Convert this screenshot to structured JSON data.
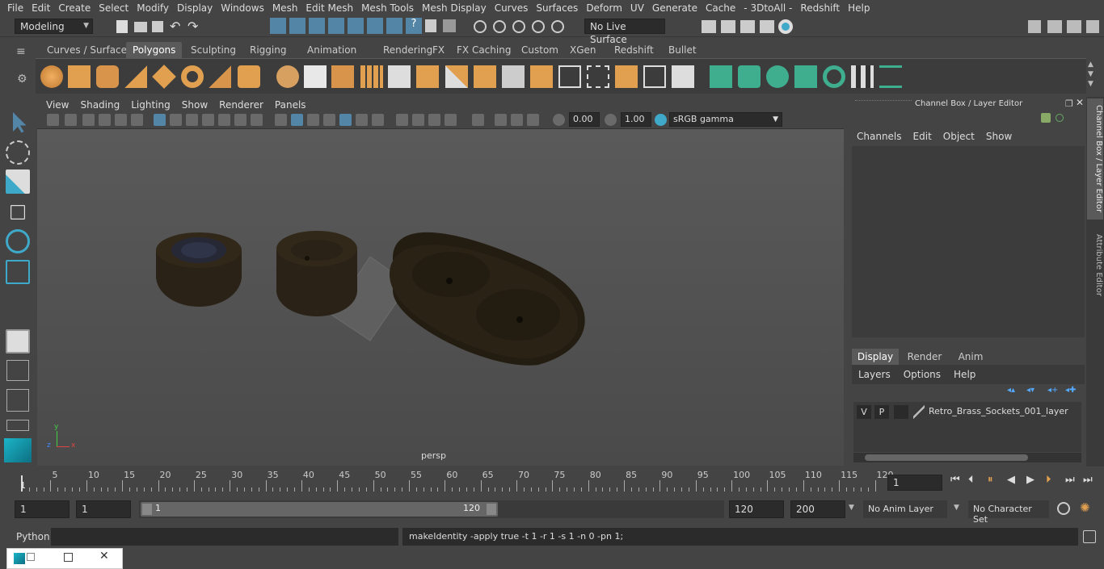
{
  "menubar": [
    "File",
    "Edit",
    "Create",
    "Select",
    "Modify",
    "Display",
    "Windows",
    "Mesh",
    "Edit Mesh",
    "Mesh Tools",
    "Mesh Display",
    "Curves",
    "Surfaces",
    "Deform",
    "UV",
    "Generate",
    "Cache",
    "- 3DtoAll -",
    "Redshift",
    "Help"
  ],
  "status": {
    "mode": "Modeling",
    "live_surface": "No Live Surface"
  },
  "shelf_tabs": [
    "Curves / Surfaces",
    "Polygons",
    "Sculpting",
    "Rigging",
    "Animation",
    "Rendering",
    "FX",
    "FX Caching",
    "Custom",
    "XGen",
    "Redshift",
    "Bullet"
  ],
  "shelf_active": "Polygons",
  "viewport": {
    "menu": [
      "View",
      "Shading",
      "Lighting",
      "Show",
      "Renderer",
      "Panels"
    ],
    "exposure": "0.00",
    "gamma": "1.00",
    "colorspace": "sRGB gamma",
    "camera": "persp",
    "axis_x": "x",
    "axis_y": "y",
    "axis_z": "z"
  },
  "channel_box": {
    "title": "Channel Box / Layer Editor",
    "menu": [
      "Channels",
      "Edit",
      "Object",
      "Show"
    ],
    "tabs": [
      "Display",
      "Render",
      "Anim"
    ],
    "active_tab": "Display",
    "layer_menu": [
      "Layers",
      "Options",
      "Help"
    ],
    "layer": {
      "v": "V",
      "p": "P",
      "name": "Retro_Brass_Sockets_001_layer"
    },
    "side_tabs": [
      "Channel Box / Layer Editor",
      "Attribute Editor"
    ]
  },
  "timeline": {
    "ticks": [
      5,
      10,
      15,
      20,
      25,
      30,
      35,
      40,
      45,
      50,
      55,
      60,
      65,
      70,
      75,
      80,
      85,
      90,
      95,
      100,
      105,
      110,
      115,
      120
    ],
    "start_label": "1",
    "current_frame": "1"
  },
  "range": {
    "start": "1",
    "playback_start": "1",
    "slider_start": "1",
    "slider_end": "120",
    "playback_end": "120",
    "end": "200",
    "anim_layer": "No Anim Layer",
    "character_set": "No Character Set"
  },
  "command": {
    "language": "Python",
    "result": "makeIdentity -apply true -t 1 -r 1 -s 1 -n 0 -pn 1;"
  },
  "colors": {
    "accent": "#5285a6",
    "shelf_orange": "#e0a050",
    "shelf_green": "#3fae8f",
    "panel": "#444444",
    "field": "#2b2b2b"
  }
}
